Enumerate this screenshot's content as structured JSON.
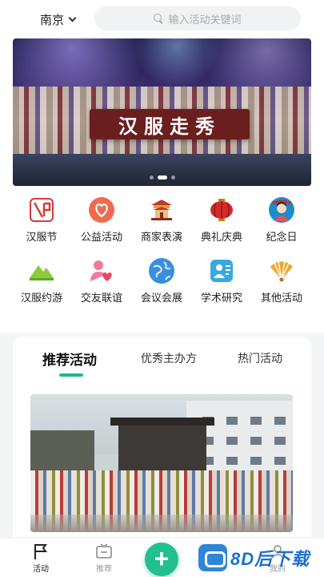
{
  "header": {
    "city": "南京",
    "search_placeholder": "输入活动关键词"
  },
  "banner": {
    "title": "汉服走秀",
    "slide_count": 3,
    "active_slide": 1
  },
  "categories": [
    {
      "label": "汉服节",
      "icon": "hanfu-festival-icon",
      "color": "#d33a3a"
    },
    {
      "label": "公益活动",
      "icon": "charity-heart-icon",
      "color": "#f06a4f"
    },
    {
      "label": "商家表演",
      "icon": "pavilion-stage-icon",
      "color": "#c0392b"
    },
    {
      "label": "典礼庆典",
      "icon": "lantern-icon",
      "color": "#d62828"
    },
    {
      "label": "纪念日",
      "icon": "anniversary-portrait-icon",
      "color": "#1a8ccf"
    },
    {
      "label": "汉服约游",
      "icon": "mountain-trip-icon",
      "color": "#8ccc3a"
    },
    {
      "label": "交友联谊",
      "icon": "friends-heart-icon",
      "color": "#f07a9a"
    },
    {
      "label": "会议会展",
      "icon": "globe-meeting-icon",
      "color": "#3a8ee0"
    },
    {
      "label": "学术研究",
      "icon": "academic-person-icon",
      "color": "#3aa8e0"
    },
    {
      "label": "其他活动",
      "icon": "fan-icon",
      "color": "#f0a72a"
    }
  ],
  "tabs": [
    {
      "label": "推荐活动",
      "active": true
    },
    {
      "label": "优秀主办方",
      "active": false
    },
    {
      "label": "热门活动",
      "active": false
    }
  ],
  "bottom_nav": [
    {
      "label": "活动",
      "icon": "flag-icon",
      "active": true
    },
    {
      "label": "推荐",
      "icon": "tv-icon",
      "active": false
    },
    {
      "label": "+",
      "icon": "add-icon",
      "active": false
    },
    {
      "label": "",
      "icon": "message-icon",
      "active": false
    },
    {
      "label": "我的",
      "icon": "profile-icon",
      "active": false
    }
  ],
  "watermark": {
    "text": "8D后下载"
  },
  "colors": {
    "accent": "#1bb98a",
    "fab": "#22c08e"
  }
}
